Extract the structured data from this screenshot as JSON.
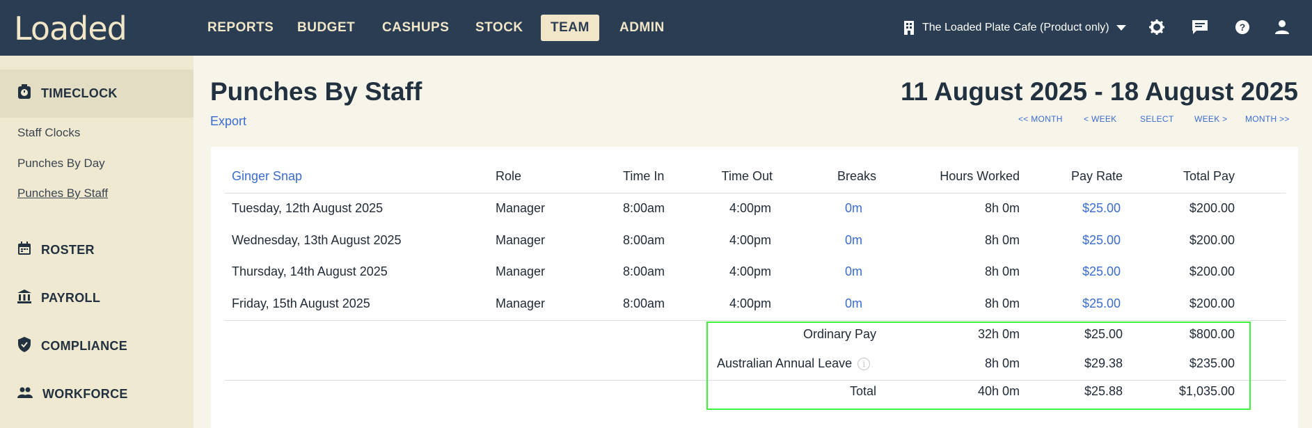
{
  "app": {
    "logo": "Loaded"
  },
  "nav": {
    "items": [
      {
        "label": "REPORTS"
      },
      {
        "label": "BUDGET"
      },
      {
        "label": "CASHUPS"
      },
      {
        "label": "STOCK"
      },
      {
        "label": "TEAM",
        "active": true
      },
      {
        "label": "ADMIN"
      }
    ],
    "venue": "The Loaded Plate Cafe (Product only)",
    "icons": [
      "building-icon",
      "chevron-down-icon",
      "gear-icon",
      "chat-icon",
      "help-icon",
      "user-icon"
    ]
  },
  "sidebar": {
    "sections": [
      {
        "label": "TIMECLOCK",
        "icon": "timeclock-icon",
        "active": true
      },
      {
        "label": "ROSTER",
        "icon": "calendar-icon"
      },
      {
        "label": "PAYROLL",
        "icon": "bank-icon"
      },
      {
        "label": "COMPLIANCE",
        "icon": "shield-icon"
      },
      {
        "label": "WORKFORCE",
        "icon": "people-icon"
      }
    ],
    "links": [
      {
        "label": "Staff Clocks"
      },
      {
        "label": "Punches By Day"
      },
      {
        "label": "Punches By Staff",
        "current": true
      }
    ]
  },
  "page": {
    "title": "Punches By Staff",
    "export": "Export",
    "date_range": "11 August 2025 - 18 August 2025",
    "date_nav": [
      "<< MONTH",
      "< WEEK",
      "SELECT",
      "WEEK >",
      "MONTH >>"
    ]
  },
  "table": {
    "staff_name": "Ginger Snap",
    "headers": [
      "Role",
      "Time In",
      "Time Out",
      "Breaks",
      "Hours Worked",
      "Pay Rate",
      "Total Pay"
    ],
    "rows": [
      {
        "date": "Tuesday, 12th August 2025",
        "role": "Manager",
        "time_in": "8:00am",
        "time_out": "4:00pm",
        "breaks": "0m",
        "hours": "8h 0m",
        "rate": "$25.00",
        "total": "$200.00"
      },
      {
        "date": "Wednesday, 13th August 2025",
        "role": "Manager",
        "time_in": "8:00am",
        "time_out": "4:00pm",
        "breaks": "0m",
        "hours": "8h 0m",
        "rate": "$25.00",
        "total": "$200.00"
      },
      {
        "date": "Thursday, 14th August 2025",
        "role": "Manager",
        "time_in": "8:00am",
        "time_out": "4:00pm",
        "breaks": "0m",
        "hours": "8h 0m",
        "rate": "$25.00",
        "total": "$200.00"
      },
      {
        "date": "Friday, 15th August 2025",
        "role": "Manager",
        "time_in": "8:00am",
        "time_out": "4:00pm",
        "breaks": "0m",
        "hours": "8h 0m",
        "rate": "$25.00",
        "total": "$200.00"
      }
    ],
    "summary": [
      {
        "label": "Ordinary Pay",
        "hours": "32h 0m",
        "rate": "$25.00",
        "total": "$800.00"
      },
      {
        "label": "Australian Annual Leave",
        "hours": "8h 0m",
        "rate": "$29.38",
        "total": "$235.00",
        "info": "i"
      }
    ],
    "total": {
      "label": "Total",
      "hours": "40h 0m",
      "rate": "$25.88",
      "total": "$1,035.00"
    }
  }
}
